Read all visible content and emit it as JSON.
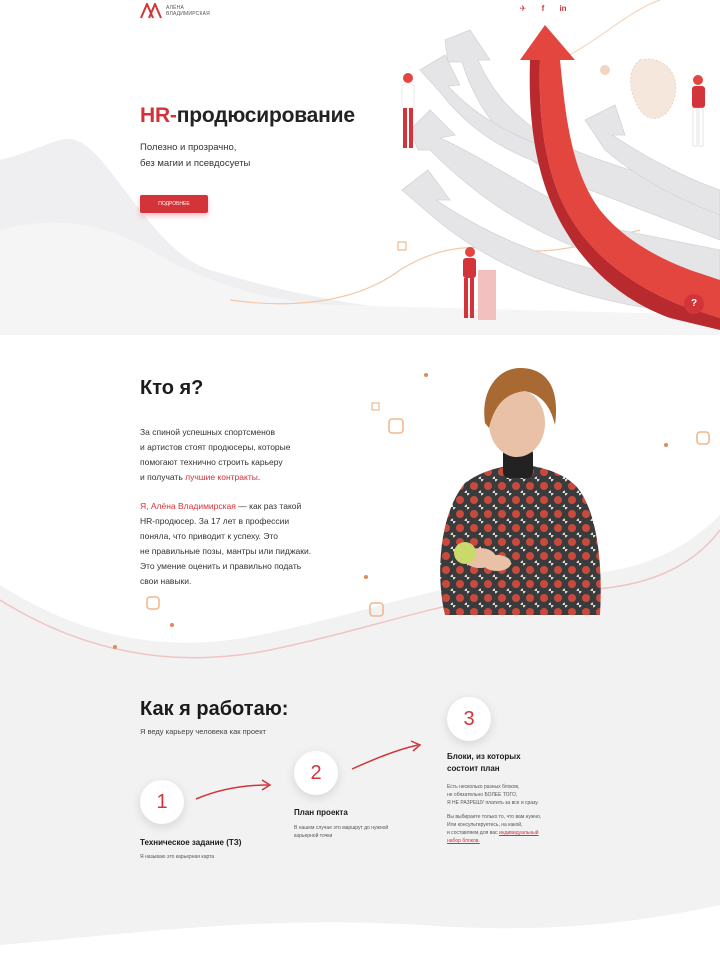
{
  "header": {
    "logo_text_line1": "АЛЁНА",
    "logo_text_line2": "ВЛАДИМИРСКАЯ",
    "socials": [
      {
        "icon": "telegram-icon",
        "glyph": "✈"
      },
      {
        "icon": "facebook-icon",
        "glyph": "f"
      },
      {
        "icon": "linkedin-icon",
        "glyph": "in"
      }
    ]
  },
  "hero": {
    "title_accent": "HR-",
    "title_rest": "продюсирование",
    "subtitle_line1": "Полезно и прозрачно,",
    "subtitle_line2": "без магии и псевдосуеты",
    "button_label": "ПОДРОБНЕЕ",
    "help_badge": "?"
  },
  "about": {
    "title": "Кто я?",
    "p1_line1": "За спиной успешных спортсменов",
    "p1_line2": "и артистов стоят продюсеры, которые",
    "p1_line3": "помогают технично строить карьеру",
    "p1_line4_prefix": "и получать ",
    "p1_line4_accent": "лучшие контракты",
    "p1_line4_suffix": ".",
    "p2_accent": "Я, Алёна Владимирская",
    "p2_line1_suffix": " — как раз такой",
    "p2_line2": "HR-продюсер. За 17 лет в профессии",
    "p2_line3": "поняла, что приводит к успеху. Это",
    "p2_line4": "не правильные позы, мантры или пиджаки.",
    "p2_line5": "Это умение оценить и правильно подать",
    "p2_line6": "свои навыки."
  },
  "how": {
    "title": "Как я работаю:",
    "subtitle": "Я веду карьеру человека как проект",
    "steps": [
      {
        "number": "1",
        "title": "Техническое задание (ТЗ)",
        "text_line1": "Я называю это карьерная карта"
      },
      {
        "number": "2",
        "title": "План проекта",
        "text_line1": "В нашем случае это маршрут до нужной",
        "text_line2": "карьерной точки"
      },
      {
        "number": "3",
        "title_line1": "Блоки, из которых",
        "title_line2": "состоит план",
        "text_line1": "Есть несколько разных блоков,",
        "text_line2": "не обязательно БОЛЕЕ ТОГО,",
        "text_line3": "Я НЕ РАЗРЕШУ платить за все и сразу.",
        "text_line4": "Вы выбираете только то, что вам нужно.",
        "text_line5": "Или консультируетесь, на какой,",
        "text_line6_prefix": "и составляем для вас ",
        "text_line6_link": "индивидуальный",
        "text_line7": "набор блоков."
      }
    ]
  },
  "colors": {
    "accent": "#d3343a",
    "text": "#1d1d1f",
    "light_gray": "#f2f2f3"
  }
}
